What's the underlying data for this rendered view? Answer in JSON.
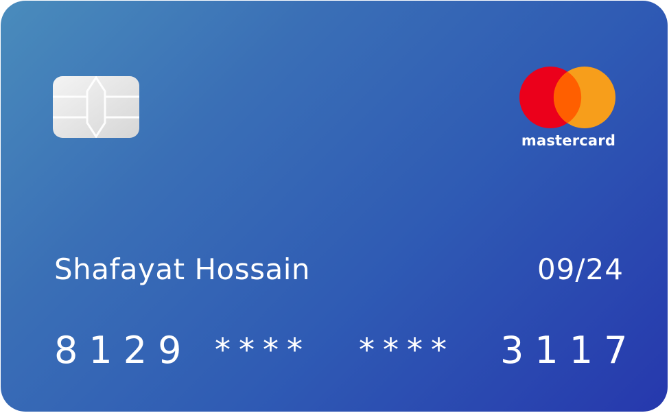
{
  "card": {
    "brand": "mastercard",
    "holder_name": "Shafayat Hossain",
    "expiry": "09/24",
    "number_groups": [
      "8129",
      "****",
      "****",
      "3117"
    ]
  },
  "icons": {
    "chip": "card-chip-icon",
    "brand_logo": "mastercard-logo"
  },
  "colors": {
    "gradient_start": "#4a8cbc",
    "gradient_end": "#2638ad",
    "logo_red": "#eb001b",
    "logo_orange": "#f79e1b",
    "logo_overlap": "#ff5f00"
  }
}
